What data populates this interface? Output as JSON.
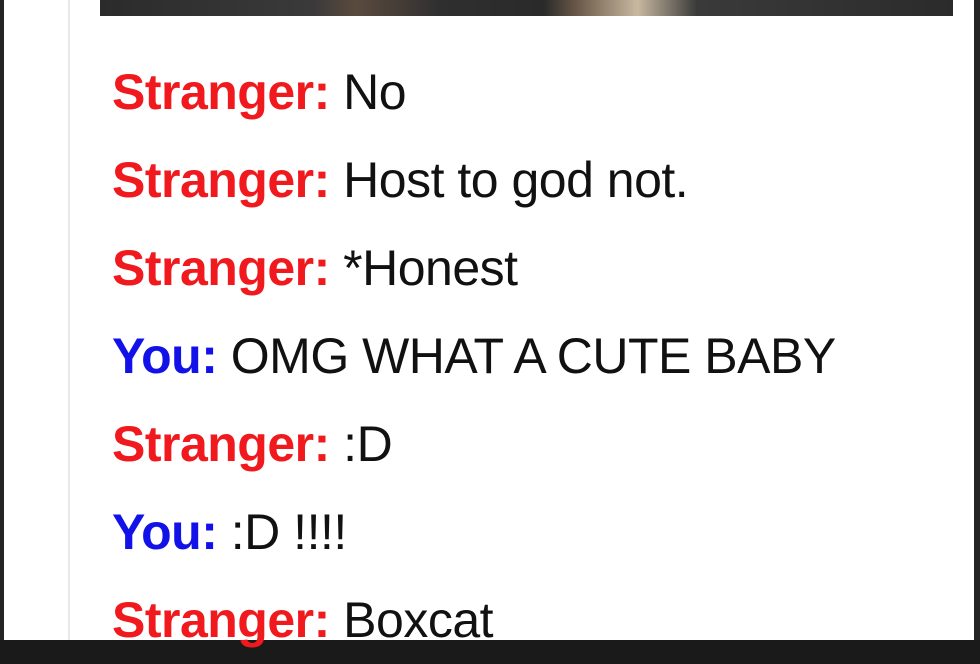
{
  "colors": {
    "stranger": "#f0191e",
    "you": "#1111e8",
    "message_text": "#111111",
    "background": "#ffffff"
  },
  "chat": {
    "messages": [
      {
        "speaker": "Stranger:",
        "role": "stranger",
        "text": "No"
      },
      {
        "speaker": "Stranger:",
        "role": "stranger",
        "text": "Host to god not."
      },
      {
        "speaker": "Stranger:",
        "role": "stranger",
        "text": "*Honest"
      },
      {
        "speaker": "You:",
        "role": "you",
        "text": "OMG WHAT A CUTE BABY"
      },
      {
        "speaker": "Stranger:",
        "role": "stranger",
        "text": ":D"
      },
      {
        "speaker": "You:",
        "role": "you",
        "text": ":D !!!!"
      },
      {
        "speaker": "Stranger:",
        "role": "stranger",
        "text": "Boxcat"
      }
    ]
  }
}
